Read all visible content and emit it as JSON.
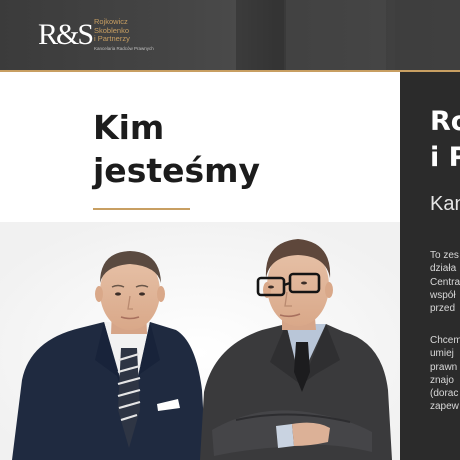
{
  "header": {
    "logo_mark": "R&S",
    "logo_lines": [
      "Rojkowicz",
      "Skoblenko",
      "i Partnerzy"
    ],
    "logo_subtitle": "Kancelaria Radców Prawnych"
  },
  "main": {
    "title": "Kim\njesteśmy"
  },
  "side_panel": {
    "heading": "Ro\ni P",
    "subtitle": "Kan",
    "paragraphs": [
      "To zes\ndziała\nCentra\nwspół\nprzed",
      "Chcem\numiej\nprawn\nznajo\n(dorac\nzapew"
    ]
  },
  "colors": {
    "header_bg": "#424242",
    "accent_gold": "#c89f62",
    "panel_bg": "#2b2b2b",
    "title_text": "#1c1c1c"
  }
}
